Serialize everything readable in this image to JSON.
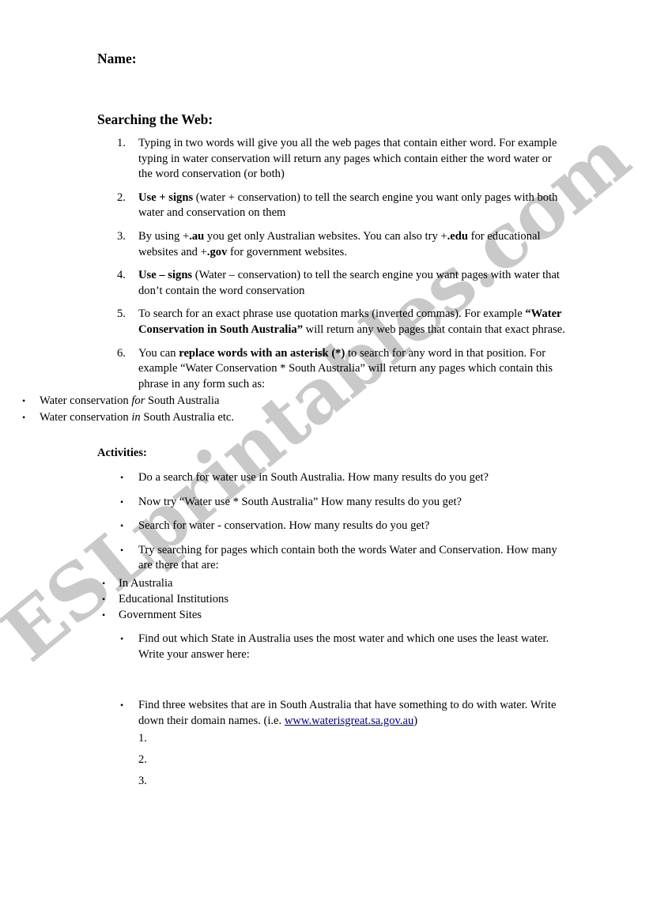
{
  "document": {
    "name_label": "Name:",
    "section_title": "Searching the Web:",
    "activities_title": "Activities:"
  },
  "colors": {
    "link": "#000080",
    "watermark": "#c9c9c9",
    "text": "#000000",
    "page_background": "#ffffff"
  },
  "watermark": {
    "text": "ESLprintables.com"
  },
  "tips": {
    "markers": [
      "1.",
      "2.",
      "3.",
      "4.",
      "5.",
      "6."
    ],
    "items": [
      {
        "id": "tip-either-word",
        "segments": [
          {
            "type": "plain",
            "text": "Typing in two words will give you all the web pages that contain either word. For example typing in water conservation will return any pages which contain either the word water or the word conservation (or both)"
          }
        ]
      },
      {
        "id": "tip-plus-signs",
        "segments": [
          {
            "type": "bold",
            "text": "Use + signs"
          },
          {
            "type": "plain",
            "text": " (water + conservation) to tell the search engine you want only pages with both water and conservation on them"
          }
        ]
      },
      {
        "id": "tip-domain-suffixes",
        "segments": [
          {
            "type": "plain",
            "text": "By using +"
          },
          {
            "type": "bold",
            "text": ".au"
          },
          {
            "type": "plain",
            "text": " you get only Australian websites.  You can also try +"
          },
          {
            "type": "bold",
            "text": ".edu"
          },
          {
            "type": "plain",
            "text": " for educational websites and +"
          },
          {
            "type": "bold",
            "text": ".gov"
          },
          {
            "type": "plain",
            "text": " for government websites."
          }
        ]
      },
      {
        "id": "tip-minus-signs",
        "segments": [
          {
            "type": "bold",
            "text": "Use – signs"
          },
          {
            "type": "plain",
            "text": " (Water – conservation) to tell the search engine you want pages with water that don’t contain the word conservation"
          }
        ]
      },
      {
        "id": "tip-quotation-marks",
        "segments": [
          {
            "type": "plain",
            "text": "To search for an exact phrase use quotation marks (inverted commas). For example "
          },
          {
            "type": "bold",
            "text": "“Water Conservation in South Australia”"
          },
          {
            "type": "plain",
            "text": " will return any web pages that contain that exact phrase."
          }
        ]
      },
      {
        "id": "tip-asterisk",
        "segments": [
          {
            "type": "plain",
            "text": "You can "
          },
          {
            "type": "bold",
            "text": "replace words with an asterisk (*)"
          },
          {
            "type": "plain",
            "text": " to search for any word in that position. For example “Water Conservation * South Australia” will return any pages which contain this phrase in any form such as:"
          }
        ],
        "subitems": [
          {
            "id": "example-for",
            "segments": [
              {
                "type": "plain",
                "text": "Water conservation "
              },
              {
                "type": "italic",
                "text": "for"
              },
              {
                "type": "plain",
                "text": "  South Australia"
              }
            ]
          },
          {
            "id": "example-in",
            "segments": [
              {
                "type": "plain",
                "text": "Water conservation "
              },
              {
                "type": "italic",
                "text": "in"
              },
              {
                "type": "plain",
                "text": "  South Australia etc."
              }
            ]
          }
        ]
      }
    ]
  },
  "activities": {
    "bullet_glyph": "•",
    "items": [
      {
        "id": "activity-water-use-sa",
        "segments": [
          {
            "type": "plain",
            "text": "Do a search for water use in South Australia. How many results do you get?"
          }
        ]
      },
      {
        "id": "activity-asterisk-search",
        "segments": [
          {
            "type": "plain",
            "text": "Now try “Water use * South Australia” How many results do you get?"
          }
        ]
      },
      {
        "id": "activity-minus-search",
        "segments": [
          {
            "type": "plain",
            "text": "Search for water - conservation. How many results do you get?"
          }
        ]
      },
      {
        "id": "activity-both-words",
        "segments": [
          {
            "type": "plain",
            "text": "Try searching for pages which contain both the words Water and Conservation. How many are there that are:"
          }
        ],
        "subitems": [
          {
            "id": "sub-in-australia",
            "segments": [
              {
                "type": "plain",
                "text": "In Australia"
              }
            ]
          },
          {
            "id": "sub-educational-institutions",
            "segments": [
              {
                "type": "plain",
                "text": "Educational Institutions"
              }
            ]
          },
          {
            "id": "sub-government-sites",
            "segments": [
              {
                "type": "plain",
                "text": "Government Sites"
              }
            ]
          }
        ]
      },
      {
        "id": "activity-most-least-water",
        "spacer_after": true,
        "segments": [
          {
            "type": "plain",
            "text": "Find out which State in Australia uses the most water and which one uses the least water. Write your answer here:"
          }
        ]
      },
      {
        "id": "activity-three-websites",
        "segments": [
          {
            "type": "plain",
            "text": "Find three websites that are in South Australia that have something to do with water. Write down their domain names. (i.e. "
          },
          {
            "type": "link",
            "text": "www.waterisgreat.sa.gov.au"
          },
          {
            "type": "plain",
            "text": ")"
          }
        ]
      }
    ],
    "answer_markers": [
      "1.",
      "2.",
      "3."
    ]
  }
}
